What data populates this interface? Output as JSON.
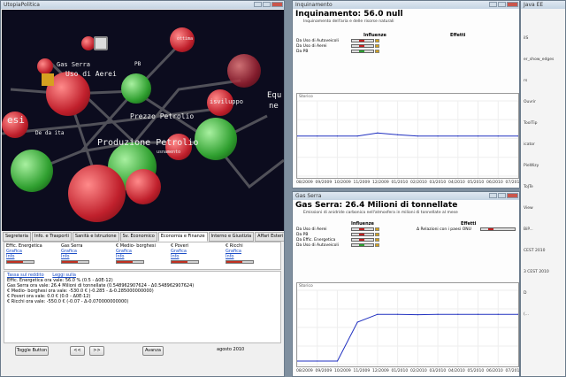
{
  "main_window": {
    "title": "UtopiaPolitica",
    "graph_labels": {
      "gas_serra": "Gas Serra",
      "uso_di_aerei": "Uso di Aerei",
      "prezzo_petrolio": "Prezzo Petrolio",
      "produzione_petrolio": "Produzione Petrolio",
      "esi": "esi",
      "de_da_ita": "De da ita",
      "sviluppo": "isviluppo",
      "ottima": "ottima",
      "eq": "Equ",
      "ne": "ne",
      "pb": "PB",
      "usnamento": "usnamento"
    },
    "tabs": [
      "Segreteria",
      "Info. e Trasporti",
      "Sanità e Istruzione",
      "Sv. Economico",
      "Economia e Finanze",
      "Interno e Giustizia",
      "Affari Esteri"
    ],
    "active_tab": "Economia e Finanze",
    "indicators": [
      {
        "name": "Effic. Energetica",
        "link1": "Grafica",
        "link2": "Info"
      },
      {
        "name": "Gas Serra",
        "link1": "Grafica",
        "link2": "Info"
      },
      {
        "name": "€ Medio- borghesi",
        "link1": "Grafica",
        "link2": "Info"
      },
      {
        "name": "€ Poveri",
        "link1": "Grafica",
        "link2": "Info"
      },
      {
        "name": "€ Ricchi",
        "link1": "Grafica",
        "link2": "Info"
      }
    ],
    "log_links": [
      "Tassa sul reddito",
      "Leggi sulla"
    ],
    "log_lines": [
      "Effic. Energetica ora vale: 56.0 % (0.5 - Δ0E-12)",
      "Gas Serra ora vale: 26.4 Milioni di tonnellate (0.548962907624 - Δ0.548962907624)",
      "€ Medio- borghesi ora vale: -530.0 € (-0.285 - Δ-0.285000000000)",
      "€ Poveri ora vale: 0.0 € (0.0 - Δ0E-12)",
      "€ Ricchi ora vale: -550.0 € (-0.07 - Δ-0.070000000000)"
    ],
    "toggle_button": "Toggle Button",
    "prev_button": "<<",
    "next_button": ">>",
    "avanza_button": "Avanza",
    "date": "agosto 2010"
  },
  "inquinamento_window": {
    "title": "Inquinamento",
    "heading": "Inquinamento: 56.0 null",
    "subtitle": "Inquinamento dell'aria e delle risorse naturali",
    "influenze_label": "Influenze",
    "effetti_label": "Effetti",
    "influenze": [
      "Da Uso di Autoveicoli",
      "Da Uso di Aerei",
      "Da PB"
    ],
    "chart_label": "Storico",
    "xticks": [
      "08/2009",
      "09/2009",
      "10/2009",
      "11/2009",
      "12/2009",
      "01/2010",
      "02/2010",
      "03/2010",
      "04/2010",
      "05/2010",
      "06/2010",
      "07/2010"
    ]
  },
  "gasserra_window": {
    "title": "Gas Serra",
    "heading": "Gas Serra: 26.4 Milioni di tonnellate",
    "subtitle": "Emissioni di anidride carbonica nell'atmosfera in milioni di tonnellate al mese",
    "influenze_label": "Influenze",
    "effetti_label": "Effetti",
    "influenze": [
      "Da Uso di Aerei",
      "Da PB",
      "Da Effic. Energetica",
      "Da Uso di Autoveicoli"
    ],
    "effetti": [
      "Δ Relazioni con i paesi ONU"
    ],
    "chart_label": "Storico",
    "xticks": [
      "08/2009",
      "09/2009",
      "10/2009",
      "11/2009",
      "12/2009",
      "01/2010",
      "02/2010",
      "03/2010",
      "04/2010",
      "05/2010",
      "06/2010",
      "07/2010"
    ]
  },
  "ide_panel": {
    "tab": "Java EE",
    "lines": [
      "ilS",
      "er_show_edges",
      "rs",
      "Ouvrir",
      "ToolTip",
      "icator",
      "PieWizy",
      "ToJTe",
      "View",
      "BiP...",
      "CEST 2010",
      "3 CEST 2010",
      "D",
      "(..."
    ]
  },
  "chart_data": [
    {
      "type": "line",
      "title": "Inquinamento: 56.0 null",
      "categories": [
        "08/2009",
        "09/2009",
        "10/2009",
        "11/2009",
        "12/2009",
        "01/2010",
        "02/2010",
        "03/2010",
        "04/2010",
        "05/2010",
        "06/2010",
        "07/2010"
      ],
      "values": [
        56.0,
        56.0,
        56.0,
        56.0,
        57.2,
        56.5,
        56.0,
        56.0,
        56.0,
        56.0,
        56.0,
        56.0
      ]
    },
    {
      "type": "line",
      "title": "Gas Serra: 26.4 Milioni di tonnellate",
      "categories": [
        "08/2009",
        "09/2009",
        "10/2009",
        "11/2009",
        "12/2009",
        "01/2010",
        "02/2010",
        "03/2010",
        "04/2010",
        "05/2010",
        "06/2010",
        "07/2010"
      ],
      "values": [
        0,
        0,
        0,
        22.0,
        26.4,
        26.4,
        26.2,
        26.4,
        26.4,
        26.4,
        26.4,
        26.4
      ]
    }
  ]
}
